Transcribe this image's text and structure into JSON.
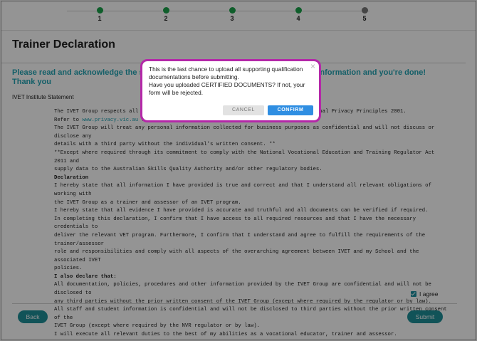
{
  "stepper": {
    "steps": [
      {
        "label": "1",
        "state": "done"
      },
      {
        "label": "2",
        "state": "done"
      },
      {
        "label": "3",
        "state": "done"
      },
      {
        "label": "4",
        "state": "done"
      },
      {
        "label": "5",
        "state": "pending"
      }
    ],
    "colors": {
      "done": "#1aa34a",
      "pending": "#777777"
    }
  },
  "page": {
    "title": "Trainer Declaration",
    "subtitle": "Please read and acknowledge the statement below, including agreement & trainer information and you're done! Thank you",
    "section_label": "IVET Institute Statement"
  },
  "statement": {
    "lines": [
      "The IVET Group respects all information and adheres to the Privacy Act 1988 and National Privacy Principles 2001.",
      "Refer to www.privacy.vic.au for more information.",
      "The IVET Group will treat any personal information collected for business purposes as confidential and will not discuss or disclose any",
      "details with a third party without the individual's written consent. **",
      "**Except where required through its commitment to comply with the National Vocational Education and Training Regulator Act 2011 and",
      "supply data to the Australian Skills Quality Authority and/or other regulatory bodies.",
      "Declaration",
      "I hereby state that all information I have provided is true and correct and that I understand all relevant obligations of working with",
      "the IVET Group as a trainer and assessor of an IVET program.",
      "I hereby state that all evidence I have provided is accurate and truthful and all documents can be verified if required.",
      "In completing this declaration, I confirm that I have access to all required resources and that I have the necessary credentials to",
      "deliver the relevant VET program. Furthermore, I confirm that I understand and agree to fulfill the requirements of the trainer/assessor",
      "role and responsibilities and comply with all aspects of the overarching agreement between IVET and my School and the associated IVET",
      "policies.",
      "I also declare that:",
      "All documentation, policies, procedures and other information provided by the IVET Group are confidential and will not be disclosed to",
      "any third parties without the prior written consent of the IVET Group (except where required by the regulator or by law).",
      "All staff and student information is confidential and will not be disclosed to third parties without the prior written consent of the",
      "IVET Group (except where required by the NVR regulator or by law).",
      "I will execute all relevant duties to the best of my abilities as a vocational educator, trainer and assessor."
    ],
    "link_text": "www.privacy.vic.au"
  },
  "agree": {
    "label": "I agree",
    "checked": true
  },
  "buttons": {
    "back": "Back",
    "submit": "Submit"
  },
  "modal": {
    "line1": "This is the last chance to upload all supporting qualification documentations before submitting.",
    "line2": "Have you uploaded CERTIFIED DOCUMENTS? If not, your form will be rejected.",
    "close": "×",
    "cancel": "CANCEL",
    "confirm": "CONFIRM",
    "highlight_color": "#b428a8"
  }
}
